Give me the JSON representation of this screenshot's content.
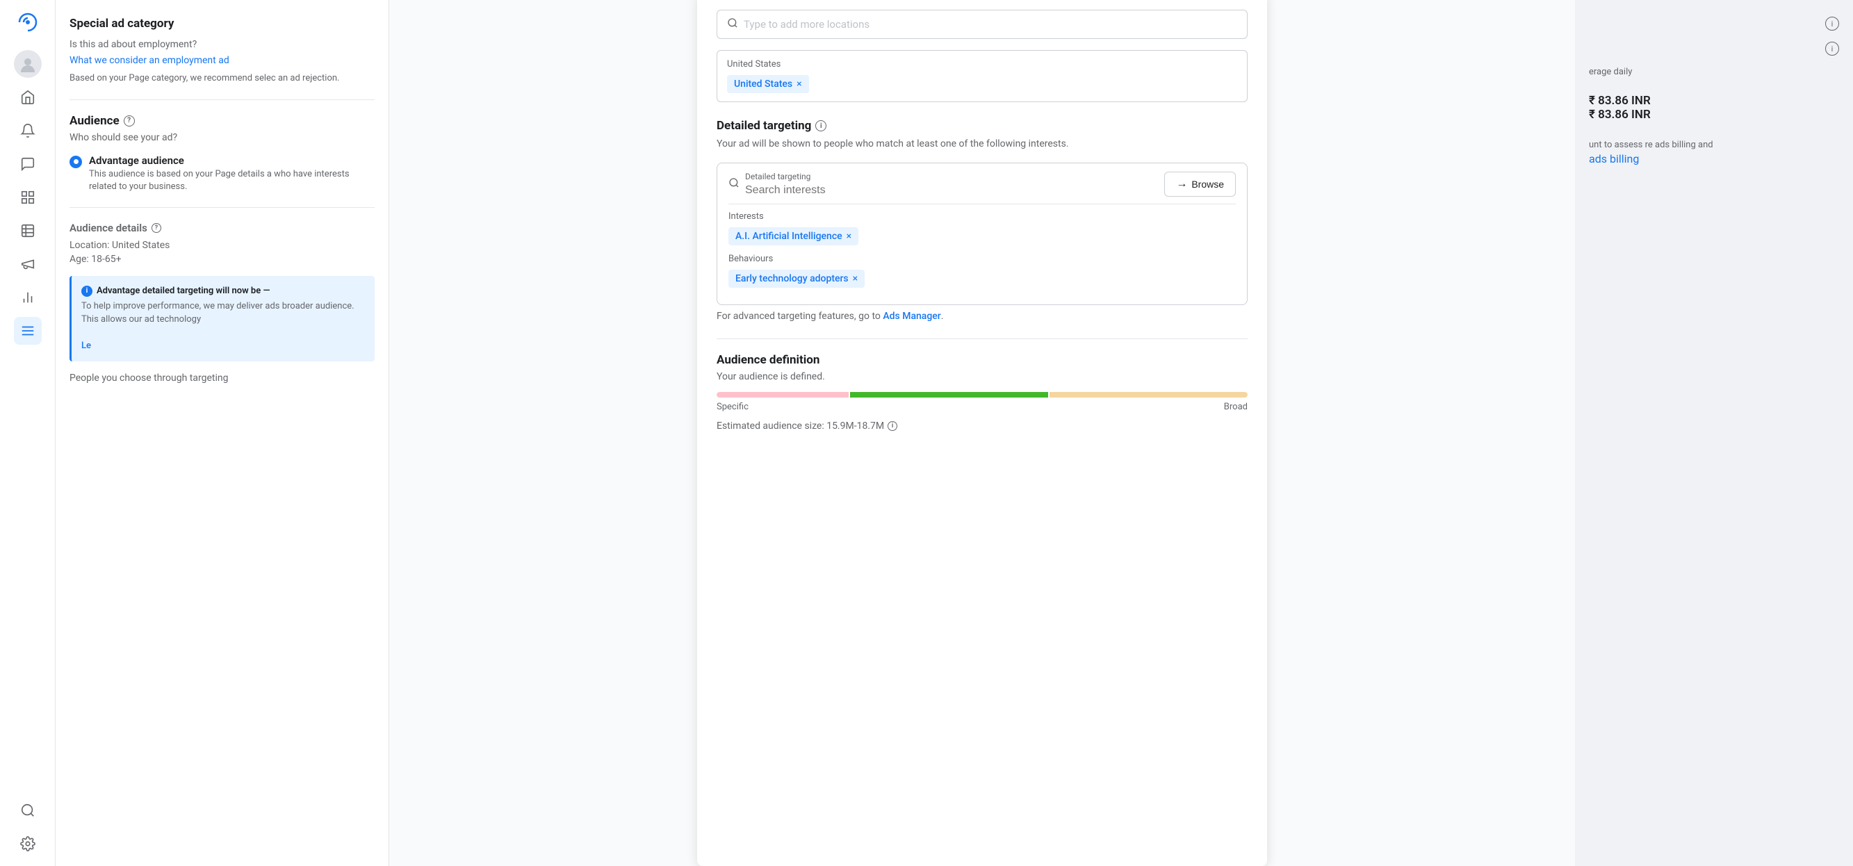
{
  "sidebar": {
    "logo_alt": "Meta logo",
    "icons": [
      {
        "name": "avatar",
        "label": "User avatar"
      },
      {
        "name": "home",
        "label": "Home"
      },
      {
        "name": "notifications",
        "label": "Notifications"
      },
      {
        "name": "messages",
        "label": "Messages"
      },
      {
        "name": "pages",
        "label": "Pages"
      },
      {
        "name": "grid",
        "label": "Grid"
      },
      {
        "name": "megaphone",
        "label": "Ads"
      },
      {
        "name": "chart",
        "label": "Analytics"
      },
      {
        "name": "active-menu",
        "label": "Menu"
      },
      {
        "name": "search",
        "label": "Search"
      },
      {
        "name": "settings",
        "label": "Settings"
      }
    ]
  },
  "left_panel": {
    "special_ad_title": "Special ad category",
    "employment_question": "Is this ad about employment?",
    "employment_link": "What we consider an employment ad",
    "recommendation_text": "Based on your Page category, we recommend selec an ad rejection.",
    "audience_title": "Audience",
    "audience_question": "Who should see your ad?",
    "advantage_label": "Advantage audience",
    "advantage_desc": "This audience is based on your Page details a who have interests related to your business.",
    "audience_details_title": "Audience details",
    "location_detail": "Location: United States",
    "age_detail": "Age: 18-65+",
    "advantage_info_title": "Advantage detailed targeting will now be —",
    "advantage_info_desc": "To help improve performance, we may deliver ads broader audience. This allows our ad technology",
    "learn_label": "Le",
    "people_targeting": "People you choose through targeting"
  },
  "modal": {
    "location_placeholder": "Type to add more locations",
    "location_tag_label": "United States",
    "location_tag_text": "United States",
    "detailed_targeting_title": "Detailed targeting",
    "detailed_targeting_desc": "Your ad will be shown to people who match at least one of the following interests.",
    "search_label": "Detailed targeting",
    "search_placeholder": "Search interests",
    "browse_label": "Browse",
    "interests_label": "Interests",
    "interest_tag": "A.I. Artificial Intelligence",
    "behaviours_label": "Behaviours",
    "behaviour_tag": "Early technology adopters",
    "advanced_text": "For advanced targeting features, go to",
    "ads_manager_link": "Ads Manager",
    "audience_def_title": "Audience definition",
    "audience_def_desc": "Your audience is defined.",
    "bar_label_specific": "Specific",
    "bar_label_broad": "Broad",
    "estimated_size_label": "Estimated audience size: 15.9M-18.7M"
  },
  "right_panel": {
    "avg_daily_label": "erage daily",
    "min_amount": "₹ 83.86 INR",
    "max_amount": "₹ 83.86 INR",
    "notice_text": "unt to assess re ads billing and"
  }
}
